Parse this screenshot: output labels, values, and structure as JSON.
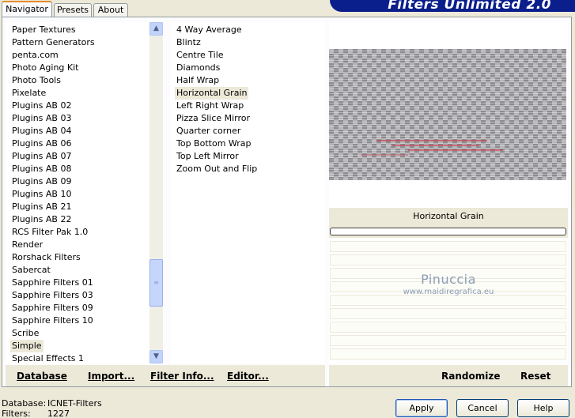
{
  "tabs": [
    "Navigator",
    "Presets",
    "About"
  ],
  "banner": "Filters Unlimited 2.0",
  "categories": {
    "items": [
      "Paper Textures",
      "Pattern Generators",
      "penta.com",
      "Photo Aging Kit",
      "Photo Tools",
      "Pixelate",
      "Plugins AB 02",
      "Plugins AB 03",
      "Plugins AB 04",
      "Plugins AB 06",
      "Plugins AB 07",
      "Plugins AB 08",
      "Plugins AB 09",
      "Plugins AB 10",
      "Plugins AB 21",
      "Plugins AB 22",
      "RCS Filter Pak 1.0",
      "Render",
      "Rorshack Filters",
      "Sabercat",
      "Sapphire Filters 01",
      "Sapphire Filters 03",
      "Sapphire Filters 09",
      "Sapphire Filters 10",
      "Scribe",
      "Simple",
      "Special Effects 1"
    ],
    "selected": "Simple"
  },
  "filters": {
    "items": [
      "4 Way Average",
      "Blintz",
      "Centre Tile",
      "Diamonds",
      "Half Wrap",
      "Horizontal Grain",
      "Left Right Wrap",
      "Pizza Slice Mirror",
      "Quarter corner",
      "Top Bottom Wrap",
      "Top Left Mirror",
      "Zoom Out and Flip"
    ],
    "selected": "Horizontal Grain"
  },
  "preview": {
    "filter_name": "Horizontal Grain",
    "watermark_title": "Pinuccia",
    "watermark_url": "www.maidiregrafica.eu"
  },
  "links_left": [
    "Database",
    "Import...",
    "Filter Info...",
    "Editor..."
  ],
  "links_right": [
    "Randomize",
    "Reset"
  ],
  "status": {
    "database_label": "Database:",
    "database_value": "ICNET-Filters",
    "filters_label": "Filters:",
    "filters_value": "1227"
  },
  "buttons": {
    "apply": "Apply",
    "cancel": "Cancel",
    "help": "Help"
  },
  "colors": {
    "banner": "#0a1e8c",
    "tab_accent": "#e68b2c",
    "selection": "#ece9d8"
  }
}
